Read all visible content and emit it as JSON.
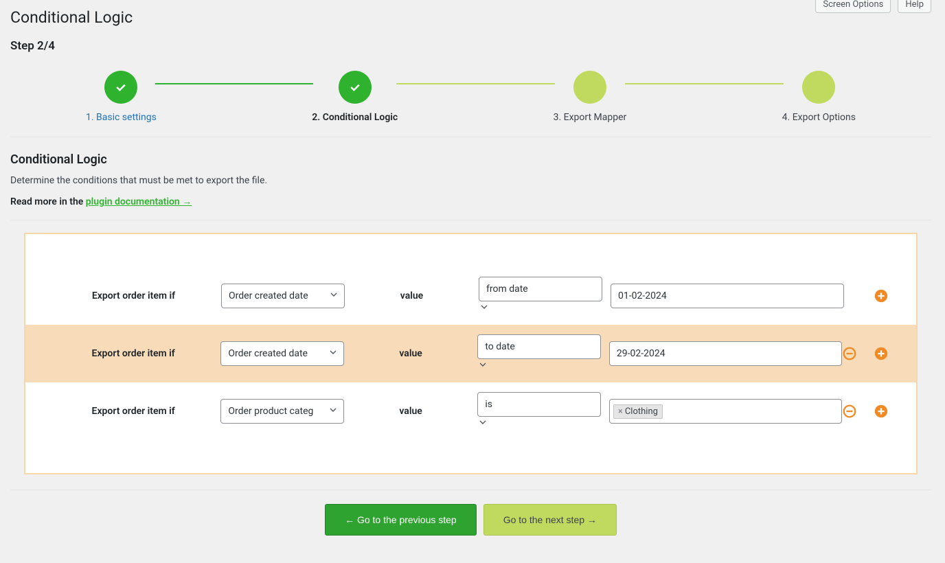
{
  "header": {
    "title": "Conditional Logic",
    "screen_options": "Screen Options",
    "help": "Help"
  },
  "step_indicator": "Step 2/4",
  "steps": [
    {
      "label": "1. Basic settings",
      "state": "done"
    },
    {
      "label": "2. Conditional Logic",
      "state": "current"
    },
    {
      "label": "3. Export Mapper",
      "state": "future"
    },
    {
      "label": "4. Export Options",
      "state": "future"
    }
  ],
  "section": {
    "title": "Conditional Logic",
    "desc": "Determine the conditions that must be met to export the file.",
    "readmore_prefix": "Read more in the ",
    "readmore_link": "plugin documentation →"
  },
  "conditions": [
    {
      "prefix": "Export order item if",
      "field": "Order created date",
      "vlabel": "value",
      "operator": "from date",
      "value": "01-02-2024",
      "value_type": "text",
      "remove": false,
      "highlight": false
    },
    {
      "prefix": "Export order item if",
      "field": "Order created date",
      "vlabel": "value",
      "operator": "to date",
      "value": "29-02-2024",
      "value_type": "text",
      "remove": true,
      "highlight": true
    },
    {
      "prefix": "Export order item if",
      "field": "Order product categ",
      "vlabel": "value",
      "operator": "is",
      "value": "Clothing",
      "value_type": "tag",
      "remove": true,
      "highlight": false
    }
  ],
  "nav": {
    "prev": "← Go to the previous step",
    "next": "Go to the next step →"
  },
  "colors": {
    "primary_green": "#2fb32f",
    "light_green": "#c0d95f",
    "orange": "#f08a24",
    "highlight_bg": "#f8dcb9",
    "border_tan": "#f5d7a8"
  }
}
